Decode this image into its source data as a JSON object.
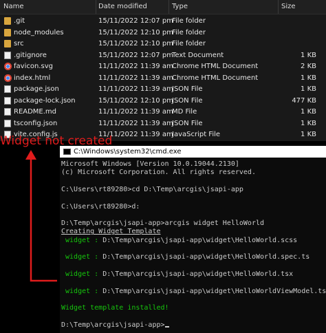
{
  "explorer": {
    "columns": [
      "Name",
      "Date modified",
      "Type",
      "Size"
    ],
    "files": [
      {
        "name": ".git",
        "date": "15/11/2022 12:07 pm",
        "type": "File folder",
        "size": "",
        "icon": "folder-icon"
      },
      {
        "name": "node_modules",
        "date": "15/11/2022 12:10 pm",
        "type": "File folder",
        "size": "",
        "icon": "folder-icon"
      },
      {
        "name": "src",
        "date": "15/11/2022 12:10 pm",
        "type": "File folder",
        "size": "",
        "icon": "folder-icon"
      },
      {
        "name": ".gitignore",
        "date": "15/11/2022 12:07 pm",
        "type": "Text Document",
        "size": "1 KB",
        "icon": "file-icon"
      },
      {
        "name": "favicon.svg",
        "date": "11/11/2022 11:39 am",
        "type": "Chrome HTML Document",
        "size": "2 KB",
        "icon": "chrome-icon"
      },
      {
        "name": "index.html",
        "date": "11/11/2022 11:39 am",
        "type": "Chrome HTML Document",
        "size": "1 KB",
        "icon": "chrome-icon"
      },
      {
        "name": "package.json",
        "date": "11/11/2022 11:39 am",
        "type": "JSON File",
        "size": "1 KB",
        "icon": "file-icon"
      },
      {
        "name": "package-lock.json",
        "date": "15/11/2022 12:10 pm",
        "type": "JSON File",
        "size": "477 KB",
        "icon": "file-icon"
      },
      {
        "name": "README.md",
        "date": "11/11/2022 11:39 am",
        "type": "MD File",
        "size": "1 KB",
        "icon": "file-icon"
      },
      {
        "name": "tsconfig.json",
        "date": "11/11/2022 11:39 am",
        "type": "JSON File",
        "size": "1 KB",
        "icon": "file-icon"
      },
      {
        "name": "vite.config.js",
        "date": "11/11/2022 11:39 am",
        "type": "JavaScript File",
        "size": "1 KB",
        "icon": "file-icon"
      }
    ]
  },
  "annotation": {
    "label": "Widget not created",
    "color": "#e01c1c"
  },
  "cmd": {
    "title": "C:\\Windows\\system32\\cmd.exe",
    "lines": [
      {
        "text": "Microsoft Windows [Version 10.0.19044.2130]",
        "style": "normal"
      },
      {
        "text": "(c) Microsoft Corporation. All rights reserved.",
        "style": "normal"
      },
      {
        "text": "",
        "style": "normal"
      },
      {
        "text": "C:\\Users\\rt89280>cd D:\\Temp\\arcgis\\jsapi-app",
        "style": "normal"
      },
      {
        "text": "",
        "style": "normal"
      },
      {
        "text": "C:\\Users\\rt89280>d:",
        "style": "normal"
      },
      {
        "text": "",
        "style": "normal"
      },
      {
        "text": "D:\\Temp\\arcgis\\jsapi-app>arcgis widget HelloWorld",
        "style": "normal"
      },
      {
        "text": "Creating Widget Template",
        "style": "underline"
      },
      {
        "prefix": " widget : ",
        "text": "D:\\Temp\\arcgis\\jsapi-app\\widget\\HelloWorld.scss",
        "style": "widget"
      },
      {
        "text": "",
        "style": "normal"
      },
      {
        "prefix": " widget : ",
        "text": "D:\\Temp\\arcgis\\jsapi-app\\widget\\HelloWorld.spec.ts",
        "style": "widget"
      },
      {
        "text": "",
        "style": "normal"
      },
      {
        "prefix": " widget : ",
        "text": "D:\\Temp\\arcgis\\jsapi-app\\widget\\HelloWorld.tsx",
        "style": "widget"
      },
      {
        "text": "",
        "style": "normal"
      },
      {
        "prefix": " widget : ",
        "text": "D:\\Temp\\arcgis\\jsapi-app\\widget\\HelloWorldViewModel.ts",
        "style": "widget"
      },
      {
        "text": "",
        "style": "normal"
      },
      {
        "text": "Widget template installed!",
        "style": "green"
      },
      {
        "text": "",
        "style": "normal"
      },
      {
        "text": "D:\\Temp\\arcgis\\jsapi-app>",
        "style": "prompt"
      }
    ]
  }
}
